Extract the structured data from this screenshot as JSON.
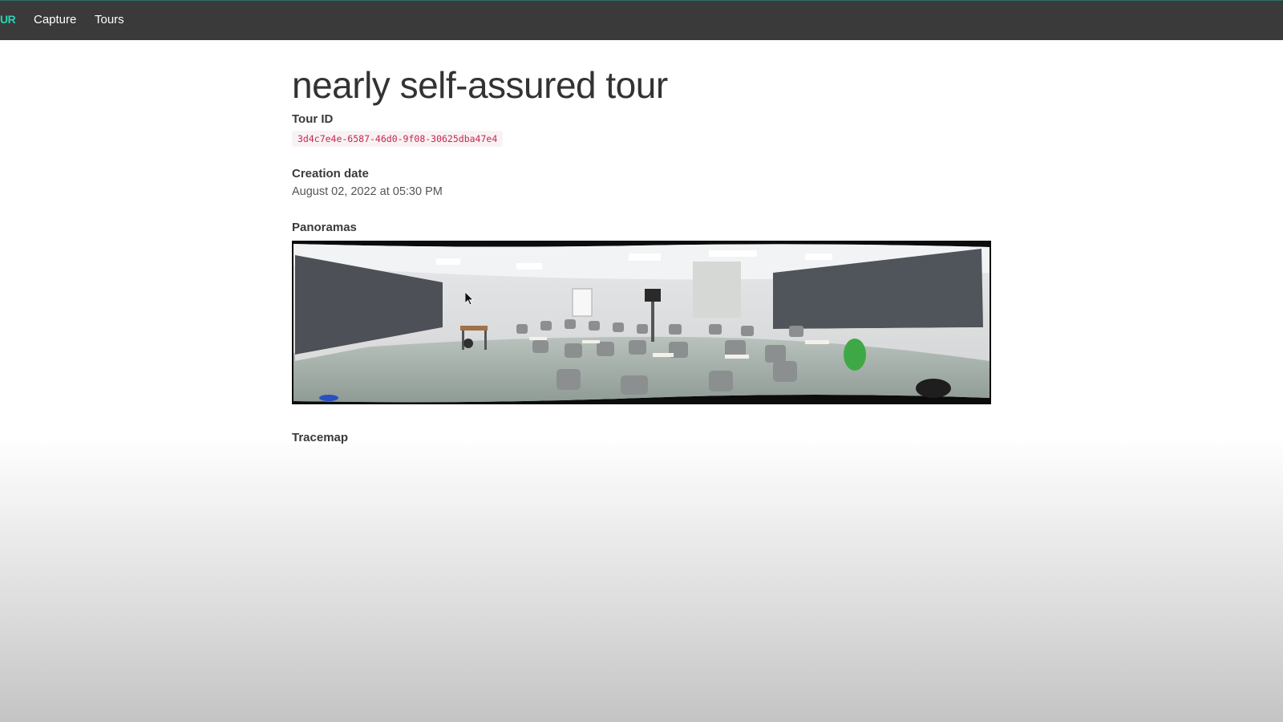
{
  "navbar": {
    "brand": "UR",
    "links": [
      "Capture",
      "Tours"
    ]
  },
  "tour": {
    "title": "nearly self-assured tour",
    "tour_id_label": "Tour ID",
    "tour_id": "3d4c7e4e-6587-46d0-9f08-30625dba47e4",
    "creation_date_label": "Creation date",
    "creation_date": "August 02, 2022 at 05:30 PM",
    "panoramas_label": "Panoramas",
    "tracemap_label": "Tracemap"
  },
  "colors": {
    "navbar_bg": "#3a3a3a",
    "brand": "#2bd1b5",
    "code_text": "#c7254e",
    "code_bg": "#f9f2f4"
  }
}
